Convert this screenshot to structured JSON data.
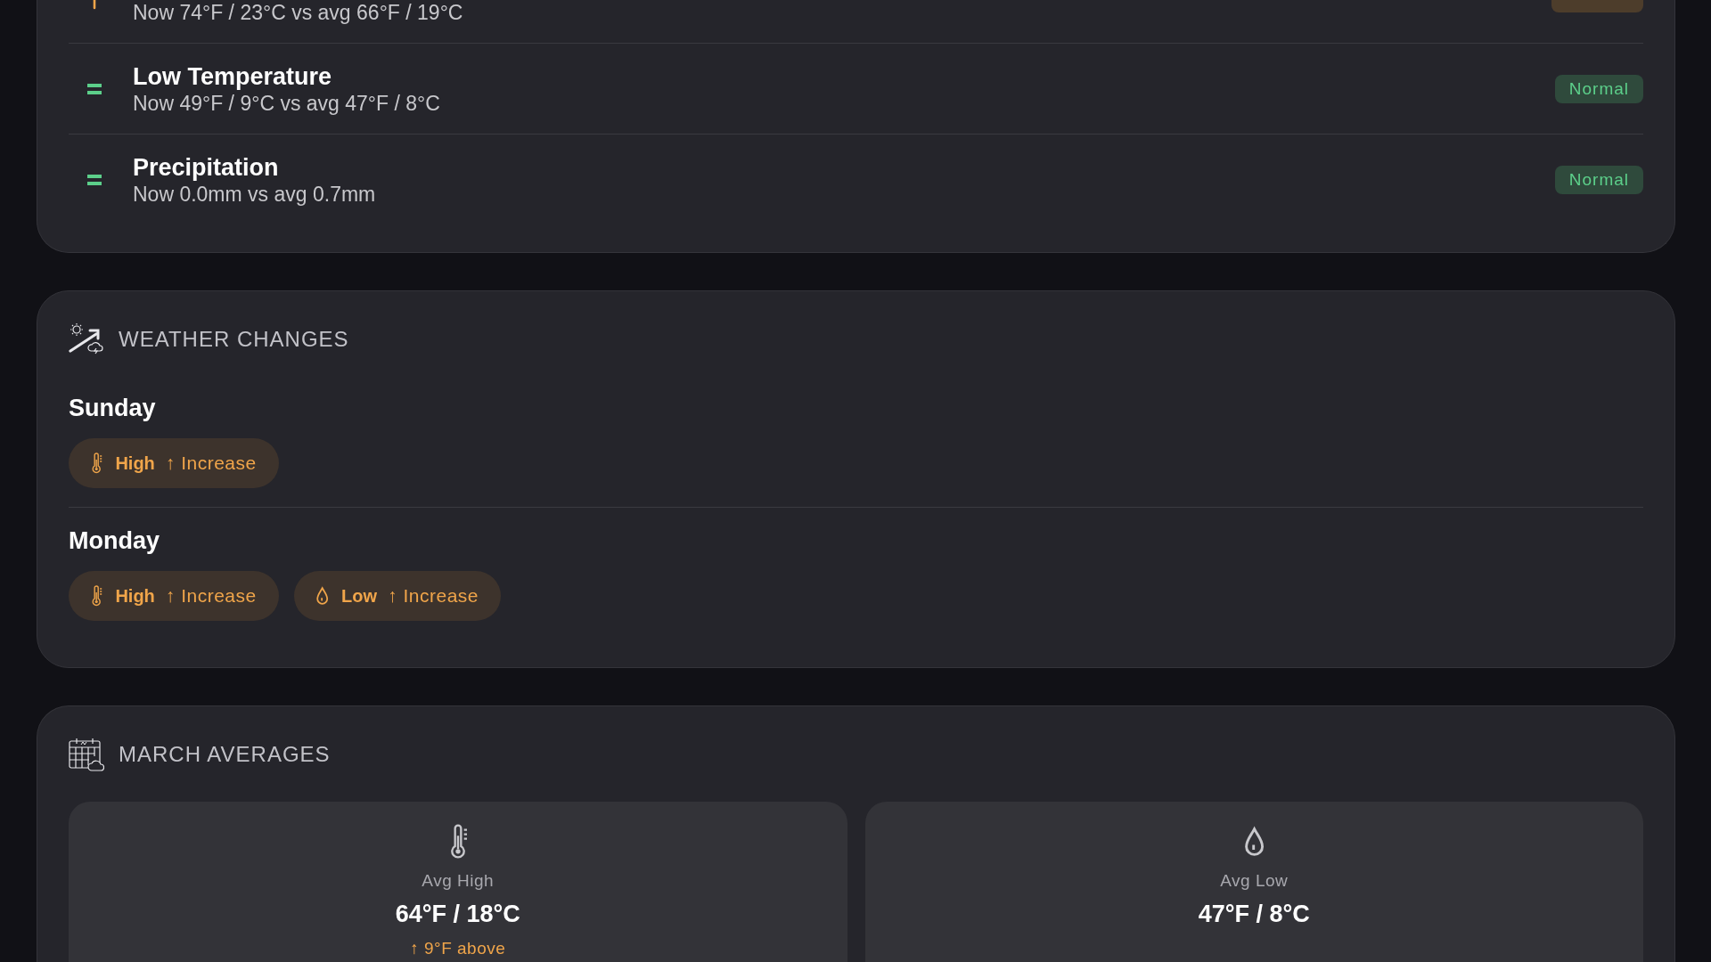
{
  "comparison": {
    "rows": [
      {
        "kind": "up",
        "detail": "Now 74°F / 23°C vs avg 66°F / 19°C",
        "status": {
          "kind": "higher"
        }
      },
      {
        "kind": "same",
        "title": "Low Temperature",
        "detail": "Now 49°F / 9°C vs avg 47°F / 8°C",
        "status": {
          "kind": "normal",
          "label": "Normal"
        }
      },
      {
        "kind": "same",
        "title": "Precipitation",
        "detail": "Now 0.0mm vs avg 0.7mm",
        "status": {
          "kind": "normal",
          "label": "Normal"
        }
      }
    ]
  },
  "weather_changes": {
    "title": "WEATHER CHANGES",
    "days": [
      {
        "day": "Sunday",
        "changes": [
          {
            "kind": "high",
            "label": "High",
            "change": "↑ Increase"
          }
        ]
      },
      {
        "day": "Monday",
        "changes": [
          {
            "kind": "high",
            "label": "High",
            "change": "↑ Increase"
          },
          {
            "kind": "low",
            "label": "Low",
            "change": "↑ Increase"
          }
        ]
      }
    ]
  },
  "march_averages": {
    "title": "MARCH AVERAGES",
    "cards": [
      {
        "kind": "high",
        "label": "Avg High",
        "value": "64°F / 18°C",
        "note": "↑ 9°F above"
      },
      {
        "kind": "low",
        "label": "Avg Low",
        "value": "47°F / 8°C"
      }
    ]
  }
}
